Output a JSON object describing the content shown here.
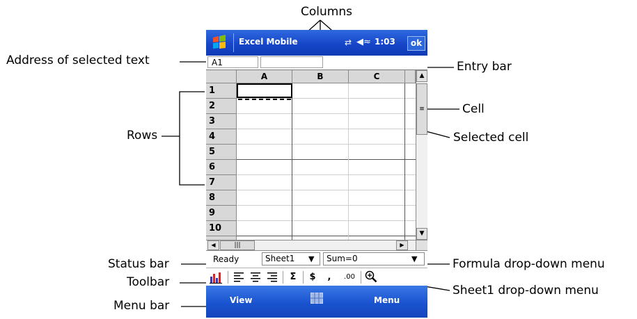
{
  "callouts": {
    "columns": "Columns",
    "address": "Address of selected text",
    "entry_bar": "Entry bar",
    "cell": "Cell",
    "rows": "Rows",
    "selected_cell": "Selected cell",
    "status_bar": "Status bar",
    "formula_menu": "Formula drop-down menu",
    "toolbar": "Toolbar",
    "sheet_menu": "Sheet1 drop-down menu",
    "menu_bar": "Menu bar"
  },
  "titlebar": {
    "app_title": "Excel Mobile",
    "time": "1:03",
    "ok_label": "ok",
    "start_icon": "windows-logo-icon",
    "conn_icon": "connectivity-icon",
    "volume_icon": "speaker-icon"
  },
  "entry": {
    "address": "A1",
    "value": ""
  },
  "grid": {
    "columns": [
      "A",
      "B",
      "C"
    ],
    "rows": [
      "1",
      "2",
      "3",
      "4",
      "5",
      "6",
      "7",
      "8",
      "9",
      "10"
    ],
    "selected": "A1"
  },
  "status": {
    "text": "Ready",
    "sheet": "Sheet1",
    "formula": "Sum=0"
  },
  "toolbar": {
    "items": [
      "chart-icon",
      "align-left-icon",
      "align-center-icon",
      "align-right-icon",
      "autosum-icon",
      "currency-icon",
      "comma-style-icon",
      "decimal-icon",
      "zoom-icon"
    ],
    "sum": "Σ",
    "currency": "$",
    "comma": ",",
    "decimal": ".00"
  },
  "menubar": {
    "left": "View",
    "right": "Menu",
    "sip_icon": "keyboard-icon"
  },
  "colors": {
    "title_bar": "#1646c8",
    "menu_bar": "#1a53cf",
    "header_gray": "#d8d8d8"
  }
}
